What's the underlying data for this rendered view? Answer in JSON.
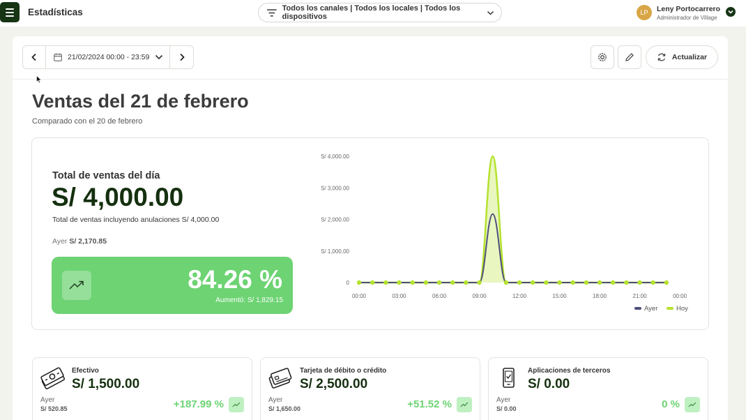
{
  "header": {
    "app_title": "Estadísticas",
    "filter_text": "Todos los canales | Todos los locales | Todos los dispositivos",
    "user_initials": "LP",
    "user_name": "Leny Portocarrero",
    "user_role": "Administrador de Village"
  },
  "toolbar": {
    "date_range": "21/02/2024 00:00 - 23:59",
    "refresh_label": "Actualizar"
  },
  "page": {
    "title": "Ventas del 21 de febrero",
    "subtitle": "Comparado con el 20 de febrero"
  },
  "summary": {
    "total_label": "Total de ventas del día",
    "total_value": "S/ 4,000.00",
    "total_note": "Total de ventas incluyendo anulaciones S/ 4,000.00",
    "yesterday_label": "Ayer",
    "yesterday_value": "S/ 2,170.85",
    "growth_pct": "84.26 %",
    "growth_note": "Aumentó: S/ 1,829.15"
  },
  "chart_data": {
    "type": "line",
    "x": [
      "00:00",
      "01:00",
      "02:00",
      "03:00",
      "04:00",
      "05:00",
      "06:00",
      "07:00",
      "08:00",
      "09:00",
      "10:00",
      "11:00",
      "12:00",
      "13:00",
      "14:00",
      "15:00",
      "16:00",
      "17:00",
      "18:00",
      "19:00",
      "20:00",
      "21:00",
      "22:00",
      "23:00"
    ],
    "x_tick_labels": [
      "00:00",
      "03:00",
      "06:00",
      "09:00",
      "12:00",
      "15:00",
      "18:00",
      "21:00",
      "00:00"
    ],
    "y_tick_labels": [
      "0",
      "S/ 1,000.00",
      "S/ 2,000.00",
      "S/ 3,000.00",
      "S/ 4,000.00"
    ],
    "y_ticks": [
      0,
      1000,
      2000,
      3000,
      4000
    ],
    "ylim": [
      0,
      4000
    ],
    "series": [
      {
        "name": "Ayer",
        "color": "#4e4f7c",
        "values": [
          0,
          0,
          0,
          0,
          0,
          0,
          0,
          0,
          0,
          0,
          2170.85,
          0,
          0,
          0,
          0,
          0,
          0,
          0,
          0,
          0,
          0,
          0,
          0,
          0
        ]
      },
      {
        "name": "Hoy",
        "color": "#b5e22e",
        "values": [
          0,
          0,
          0,
          0,
          0,
          0,
          0,
          0,
          0,
          0,
          4000,
          0,
          0,
          0,
          0,
          0,
          0,
          0,
          0,
          0,
          0,
          0,
          0,
          0
        ]
      }
    ],
    "legend_position": "bottom-right",
    "grid": false
  },
  "payment_methods": [
    {
      "label": "Efectivo",
      "value": "S/ 1,500.00",
      "yesterday_label": "Ayer",
      "yesterday_value": "S/ 520.85",
      "pct": "+187.99 %",
      "icon": "cash-icon"
    },
    {
      "label": "Tarjeta de débito o crédito",
      "value": "S/ 2,500.00",
      "yesterday_label": "Ayer",
      "yesterday_value": "S/ 1,650.00",
      "pct": "+51.52 %",
      "icon": "card-icon"
    },
    {
      "label": "Aplicaciones de terceros",
      "value": "S/ 0.00",
      "yesterday_label": "Ayer",
      "yesterday_value": "S/ 0.00",
      "pct": "0 %",
      "icon": "phone-app-icon"
    }
  ],
  "colors": {
    "brand_dark": "#173515",
    "accent_green": "#6dd373",
    "series_ayer": "#4e4f7c",
    "series_hoy": "#b5e22e"
  }
}
